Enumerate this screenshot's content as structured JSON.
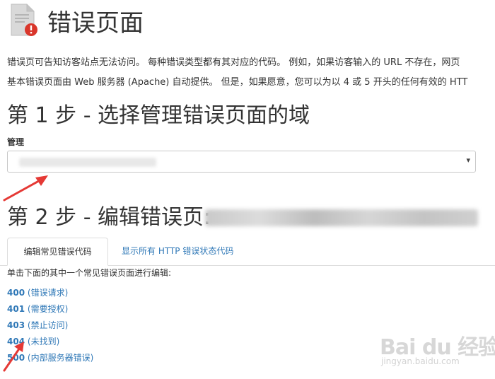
{
  "header": {
    "title": "错误页面"
  },
  "description": {
    "line1": "错误页可告知访客站点无法访问。 每种错误类型都有其对应的代码。 例如，如果访客输入的 URL 不存在，网页",
    "line2": "基本错误页面由 Web 服务器 (Apache) 自动提供。 但是，如果愿意，您可以为以 4 或 5 开头的任何有效的 HTT"
  },
  "step1": {
    "title": "第 1 步 - 选择管理错误页面的域",
    "label": "管理",
    "select_caret": "▾"
  },
  "step2": {
    "title": "第 2 步 - 编辑错误页:"
  },
  "tabs": [
    {
      "label": "编辑常见错误代码"
    },
    {
      "label": "显示所有 HTTP 错误状态代码"
    }
  ],
  "instruction": "单击下面的其中一个常见错误页面进行编辑:",
  "error_codes": [
    {
      "code": "400",
      "desc": "(错误请求)"
    },
    {
      "code": "401",
      "desc": "(需要授权)"
    },
    {
      "code": "403",
      "desc": "(禁止访问)"
    },
    {
      "code": "404",
      "desc": "(未找到)"
    },
    {
      "code": "500",
      "desc": "(内部服务器错误)"
    }
  ],
  "watermark": {
    "brand": "Bai du 经验",
    "sub": "jingyan.baidu.com"
  },
  "colors": {
    "link": "#2f78b7",
    "annotation_arrow": "#e53935",
    "error_badge": "#d9362b"
  }
}
